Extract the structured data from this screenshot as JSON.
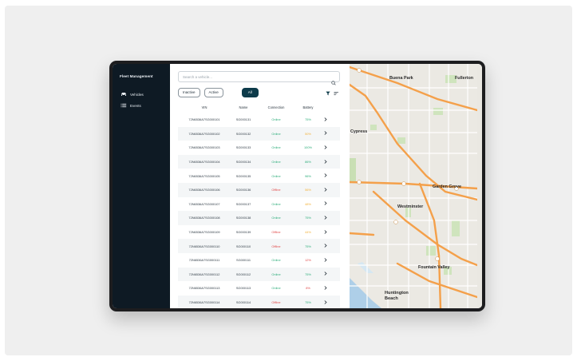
{
  "app": {
    "title": "Fleet Management"
  },
  "sidebar": {
    "items": [
      {
        "label": "Vehicles",
        "icon": "car-icon"
      },
      {
        "label": "Events",
        "icon": "list-icon"
      }
    ]
  },
  "search": {
    "placeholder": "Search a vehicle...",
    "value": ""
  },
  "filters": [
    {
      "label": "Inactive"
    },
    {
      "label": "Active"
    },
    {
      "label": "All",
      "selected": true
    }
  ],
  "table": {
    "columns": [
      "VIN",
      "Name",
      "Connection",
      "Battery"
    ],
    "rows": [
      {
        "vin": "72N6536A7SG000101",
        "name": "SG000131",
        "connection": "Online",
        "battery": "75%"
      },
      {
        "vin": "72N6536A7SG000102",
        "name": "SG000132",
        "connection": "Online",
        "battery": "50%"
      },
      {
        "vin": "72N6536A7SG000103",
        "name": "SG000133",
        "connection": "Online",
        "battery": "100%"
      },
      {
        "vin": "72N6536A7SG000104",
        "name": "SG000134",
        "connection": "Online",
        "battery": "86%"
      },
      {
        "vin": "72N6536A7SG000105",
        "name": "SG000135",
        "connection": "Online",
        "battery": "96%"
      },
      {
        "vin": "72N6536A7SG000106",
        "name": "SG000136",
        "connection": "Offline",
        "battery": "56%"
      },
      {
        "vin": "72N6536A7SG000107",
        "name": "SG000137",
        "connection": "Online",
        "battery": "48%"
      },
      {
        "vin": "72N6536A7SG000108",
        "name": "SG000138",
        "connection": "Online",
        "battery": "75%"
      },
      {
        "vin": "72N6536A7SG000109",
        "name": "SG000139",
        "connection": "Offline",
        "battery": "44%"
      },
      {
        "vin": "72N6536A7SG000110",
        "name": "SG000110",
        "connection": "Offline",
        "battery": "75%"
      },
      {
        "vin": "72N6536A7SG000111",
        "name": "SG000111",
        "connection": "Online",
        "battery": "12%"
      },
      {
        "vin": "72N6536A7SG000112",
        "name": "SG000112",
        "connection": "Online",
        "battery": "75%"
      },
      {
        "vin": "72N6536A7SG000113",
        "name": "SG000113",
        "connection": "Online",
        "battery": "8%"
      },
      {
        "vin": "72N6536A7SG000114",
        "name": "SG000114",
        "connection": "Offline",
        "battery": "75%"
      }
    ]
  },
  "map": {
    "places": [
      "Buena Park",
      "Fullerton",
      "Cypress",
      "Garden Grove",
      "Westminster",
      "Fountain Valley",
      "Huntington Beach"
    ]
  },
  "colors": {
    "sidebar_bg": "#0e1a24",
    "accent": "#0d3b4a",
    "online": "#2fae7b",
    "offline": "#e14b4b",
    "battery_mid": "#f2b23b",
    "map_road": "#f4a04a"
  }
}
